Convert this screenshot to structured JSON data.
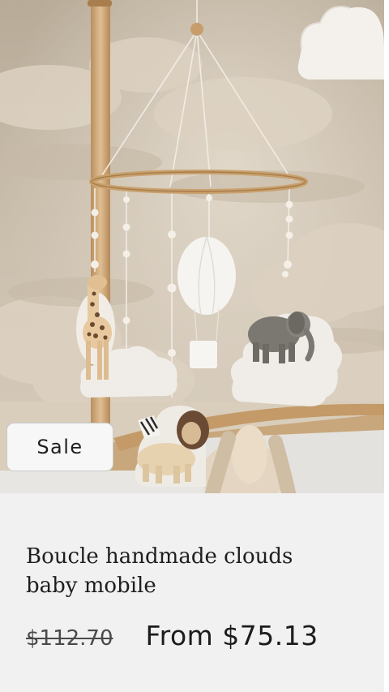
{
  "product": {
    "badge": "Sale",
    "title": "Boucle handmade clouds baby mobile",
    "compare_price": "$112.70",
    "price": "From $75.13",
    "image_subject": "baby-mobile-photo"
  },
  "colors": {
    "card_background": "#f1f1f1",
    "badge_background": "#f7f7f7",
    "text": "#1e1e1e"
  }
}
